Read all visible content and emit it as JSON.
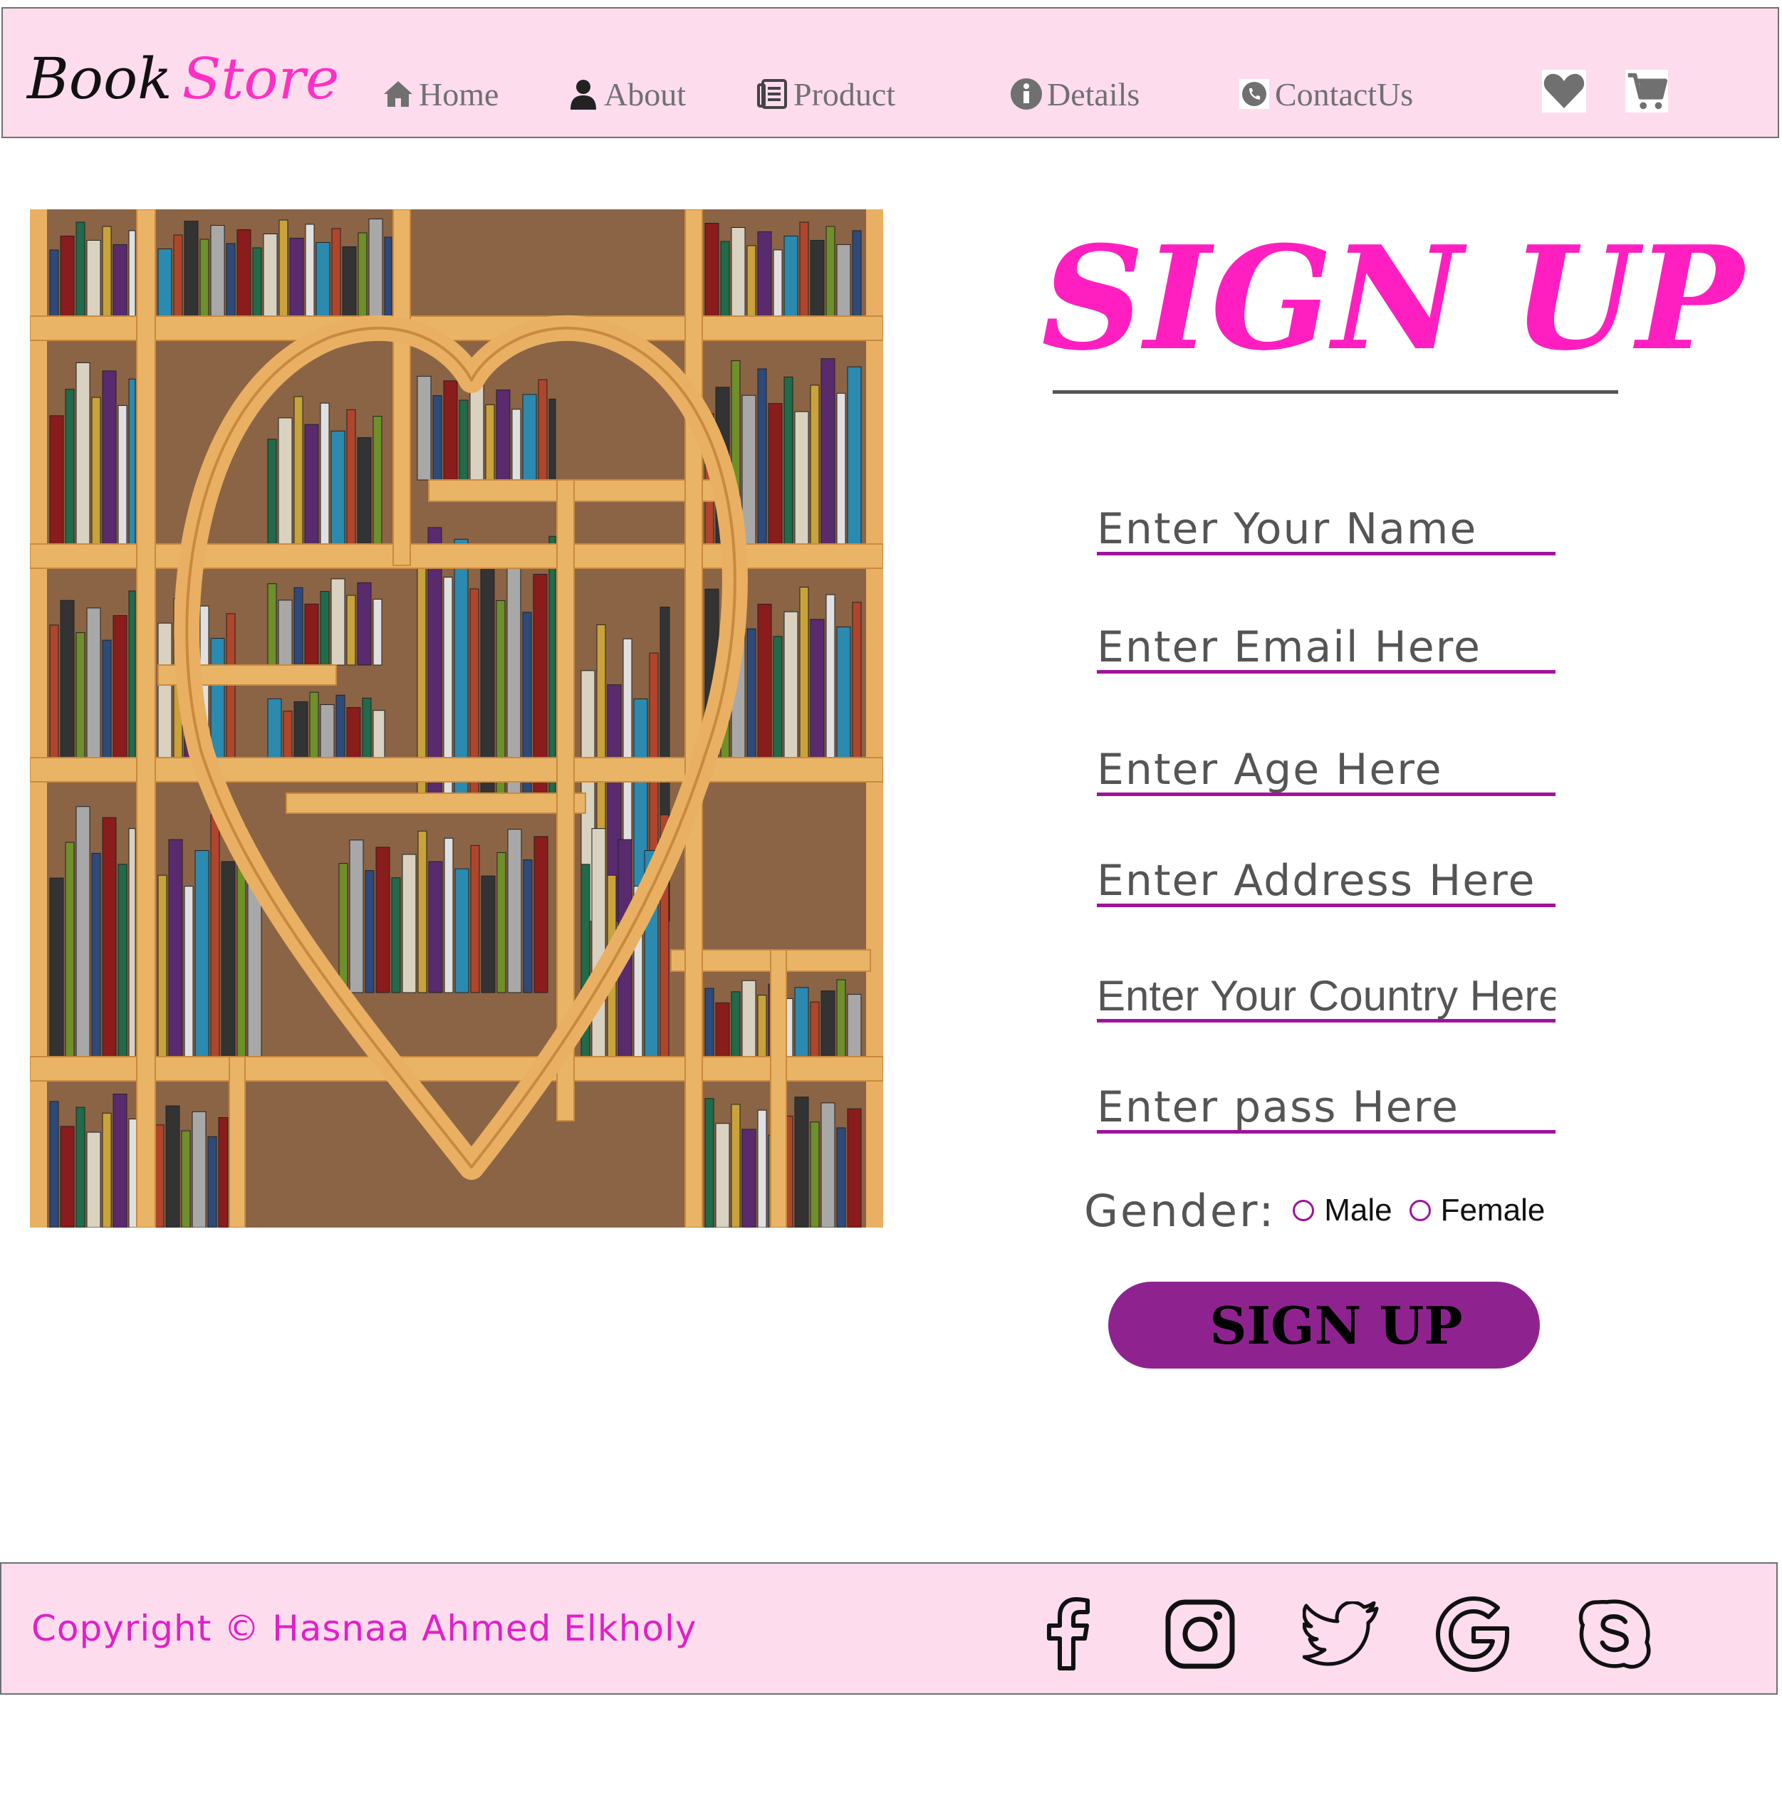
{
  "header": {
    "logo_primary": "Book",
    "logo_accent": "Store",
    "nav": [
      {
        "label": "Home",
        "icon": "home-icon"
      },
      {
        "label": "About",
        "icon": "user-icon"
      },
      {
        "label": "Product",
        "icon": "document-icon"
      },
      {
        "label": "Details",
        "icon": "info-icon"
      },
      {
        "label": "ContactUs",
        "icon": "phone-icon"
      }
    ],
    "actions": [
      {
        "icon": "heart-icon"
      },
      {
        "icon": "cart-icon"
      }
    ]
  },
  "hero": {
    "image": "heart-bookshelf-image"
  },
  "form": {
    "title": "SIGN UP",
    "fields": [
      {
        "placeholder": "Enter Your Name"
      },
      {
        "placeholder": "Enter Email Here"
      },
      {
        "placeholder": "Enter Age Here"
      },
      {
        "placeholder": "Enter Address Here"
      },
      {
        "placeholder": "Enter Your Country Here"
      },
      {
        "placeholder": "Enter pass Here"
      }
    ],
    "gender_label": "Gender:",
    "gender_options": [
      "Male",
      "Female"
    ],
    "submit_label": "SIGN UP"
  },
  "footer": {
    "copyright": "Copyright © Hasnaa Ahmed Elkholy",
    "social": [
      "facebook-icon",
      "instagram-icon",
      "twitter-icon",
      "google-icon",
      "skype-icon"
    ]
  },
  "colors": {
    "header_bg": "#fddcee",
    "accent_pink": "#ff1fc0",
    "accent_purple": "#8e2390",
    "input_underline": "#a0139d",
    "nav_text": "#707070"
  }
}
